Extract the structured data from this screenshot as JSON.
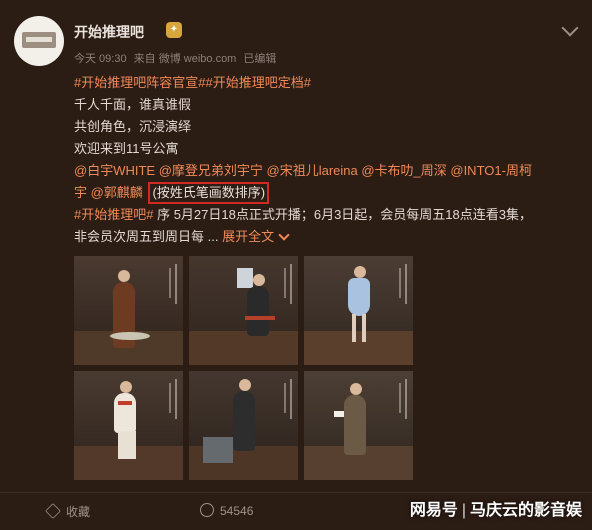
{
  "post": {
    "username": "开始推理吧",
    "meta": {
      "time": "今天 09:30",
      "source": "来自 微博 weibo.com",
      "status": "已编辑"
    },
    "lines": {
      "hashtags": "#开始推理吧阵容官宣##开始推理吧定档#",
      "l2": "千人千面，谁真谁假",
      "l3": "共创角色，沉浸演绎",
      "l4": "欢迎来到11号公寓",
      "mentions1": "@白宇WHITE @摩登兄弟刘宇宁 @宋祖儿lareina @卡布叻_周深 @INTO1-周柯",
      "mentions2_mention": "宇 @郭麒麟",
      "mentions2_note": "(按姓氏笔画数排序)",
      "l7_tag": "#开始推理吧#",
      "l7_text": " 序 5月27日18点正式开播；6月3日起，会员每周五18点连看3集，",
      "l8_text": "非会员次周五到周日每 ... ",
      "l8_expand": "展开全文"
    }
  },
  "toolbar": {
    "collect": "收藏",
    "repost": "54546"
  },
  "watermark": {
    "left": "网易号",
    "sep": "|",
    "right": "马庆云的影音娱"
  },
  "icons": [
    "collect-icon",
    "repost-icon",
    "chevron-down-icon",
    "vip-badge-icon"
  ],
  "colors": {
    "background": "#2b1c14",
    "accent": "#f08a57",
    "highlight_box": "#d12a22"
  }
}
